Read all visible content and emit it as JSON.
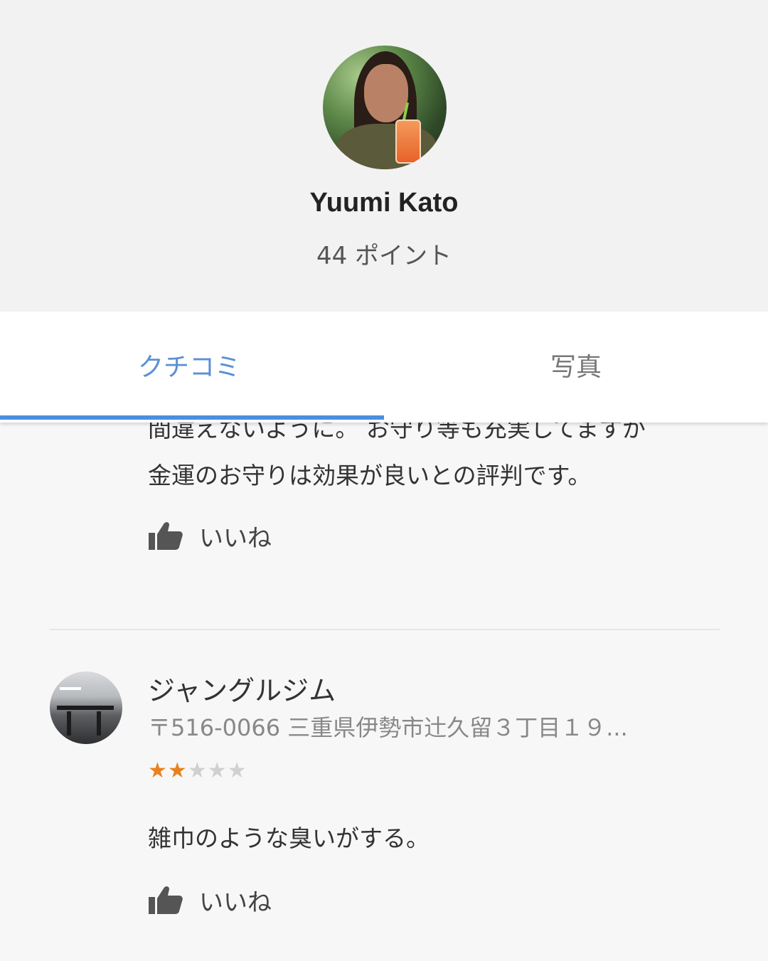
{
  "profile": {
    "name": "Yuumi Kato",
    "points": "44 ポイント"
  },
  "tabs": [
    {
      "label": "クチコミ",
      "active": true
    },
    {
      "label": "写真",
      "active": false
    }
  ],
  "reviews": [
    {
      "text_lines": [
        "間違えないように。 お守り等も充実してますが",
        "金運のお守りは効果が良いとの評判です。"
      ],
      "like_label": "いいね"
    },
    {
      "place_name": "ジャングルジム",
      "address": "〒516-0066 三重県伊勢市辻久留３丁目１９...",
      "rating": 2,
      "rating_max": 5,
      "text": "雑巾のような臭いがする。",
      "like_label": "いいね"
    }
  ],
  "colors": {
    "accent": "#4c8ee0",
    "star_filled": "#e8821f",
    "star_empty": "#d0d0d0"
  },
  "icons": [
    "thumbs-up-icon"
  ]
}
